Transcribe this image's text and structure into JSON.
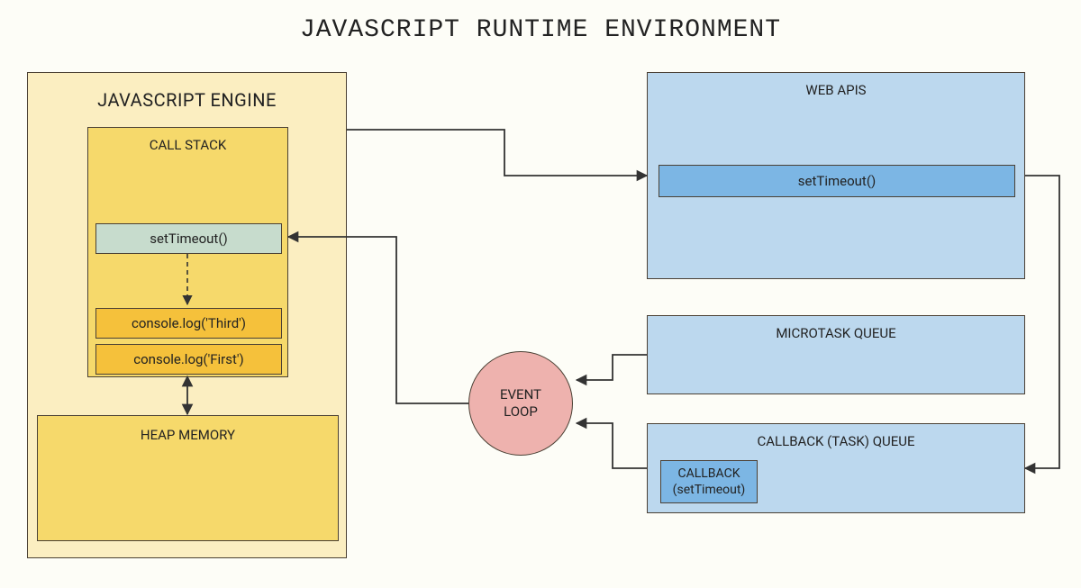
{
  "title": "JAVASCRIPT RUNTIME ENVIRONMENT",
  "engine": {
    "title": "JAVASCRIPT ENGINE",
    "callstack": {
      "title": "CALL STACK",
      "items": {
        "settimeout": "setTimeout()",
        "third": "console.log('Third')",
        "first": "console.log('First')"
      }
    },
    "heap": {
      "title": "HEAP MEMORY"
    }
  },
  "webapis": {
    "title": "WEB APIS",
    "item": "setTimeout()"
  },
  "microtask": {
    "title": "MICROTASK QUEUE"
  },
  "callbackq": {
    "title": "CALLBACK (TASK) QUEUE",
    "item": "CALLBACK\n(setTimeout)"
  },
  "eventloop": {
    "label": "EVENT\nLOOP"
  }
}
